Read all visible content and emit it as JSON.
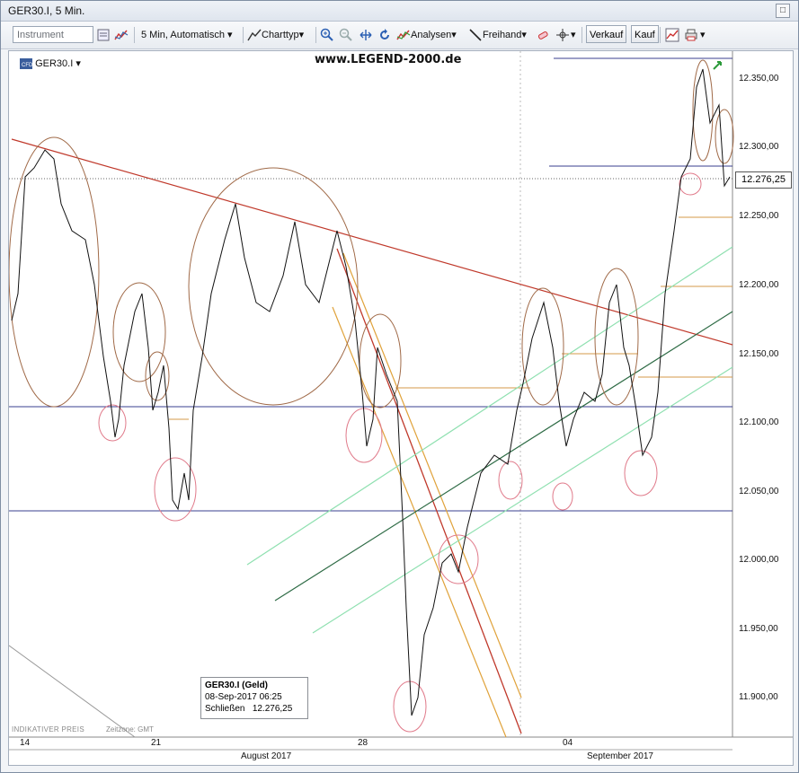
{
  "window": {
    "title": "GER30.I, 5 Min."
  },
  "toolbar": {
    "instrument_placeholder": "Instrument",
    "timeframe": "5 Min,  Automatisch",
    "charttype": "Charttyp",
    "analysen": "Analysen",
    "freihand": "Freihand",
    "verkauf": "Verkauf",
    "kauf": "Kauf"
  },
  "chart": {
    "symbol": "GER30.I",
    "watermark": "www.LEGEND-2000.de",
    "current_price": "12.276,25",
    "y_ticks": [
      "12.350,00",
      "12.300,00",
      "12.250,00",
      "12.200,00",
      "12.150,00",
      "12.100,00",
      "12.050,00",
      "12.000,00",
      "11.950,00",
      "11.900,00"
    ],
    "x_ticks": [
      "14",
      "21",
      "28",
      "04"
    ],
    "months": [
      "August 2017",
      "September 2017"
    ],
    "info": {
      "title": "GER30.I (Geld)",
      "date": "08-Sep-2017 06:25",
      "close_label": "Schließen",
      "close_value": "12.276,25"
    },
    "footer": "INDIKATIVER PREIS",
    "footer_tz": "Zeitzone: GMT"
  },
  "colors": {
    "accent": "#2b5fb3",
    "trend_red": "#c0392b",
    "orange": "#e0a23a",
    "green_dark": "#2e6b45",
    "green_light": "#8fe0b0"
  }
}
